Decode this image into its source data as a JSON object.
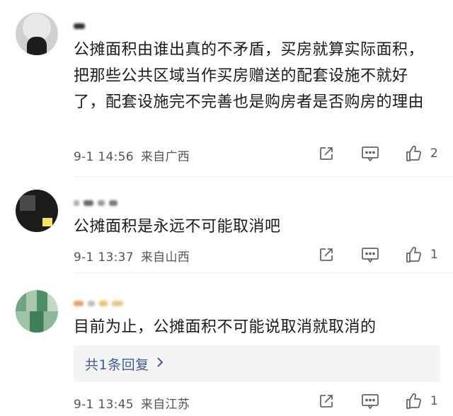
{
  "comments": [
    {
      "text": "公摊面积由谁出真的不矛盾，买房就算实际面积，把那些公共区域当作买房赠送的配套设施不就好了，配套设施完不完善也是购房者是否购房的理由",
      "time": "9-1 14:56",
      "location": "来自广西",
      "likes": "2"
    },
    {
      "text": "公摊面积是永远不可能取消吧",
      "time": "9-1 13:37",
      "location": "来自山西",
      "likes": "1"
    },
    {
      "text": "目前为止，公摊面积不可能说取消就取消的",
      "time": "9-1 13:45",
      "location": "来自江苏",
      "likes": "1",
      "replies_label": "共1条回复"
    }
  ],
  "icons": {
    "share": "share-icon",
    "comment": "comment-icon",
    "like": "thumbs-up-icon",
    "chevron": "chevron-right-icon"
  },
  "colors": {
    "link": "#3f5d93",
    "meta": "#555555",
    "reply_bg": "#f4f4f4"
  }
}
